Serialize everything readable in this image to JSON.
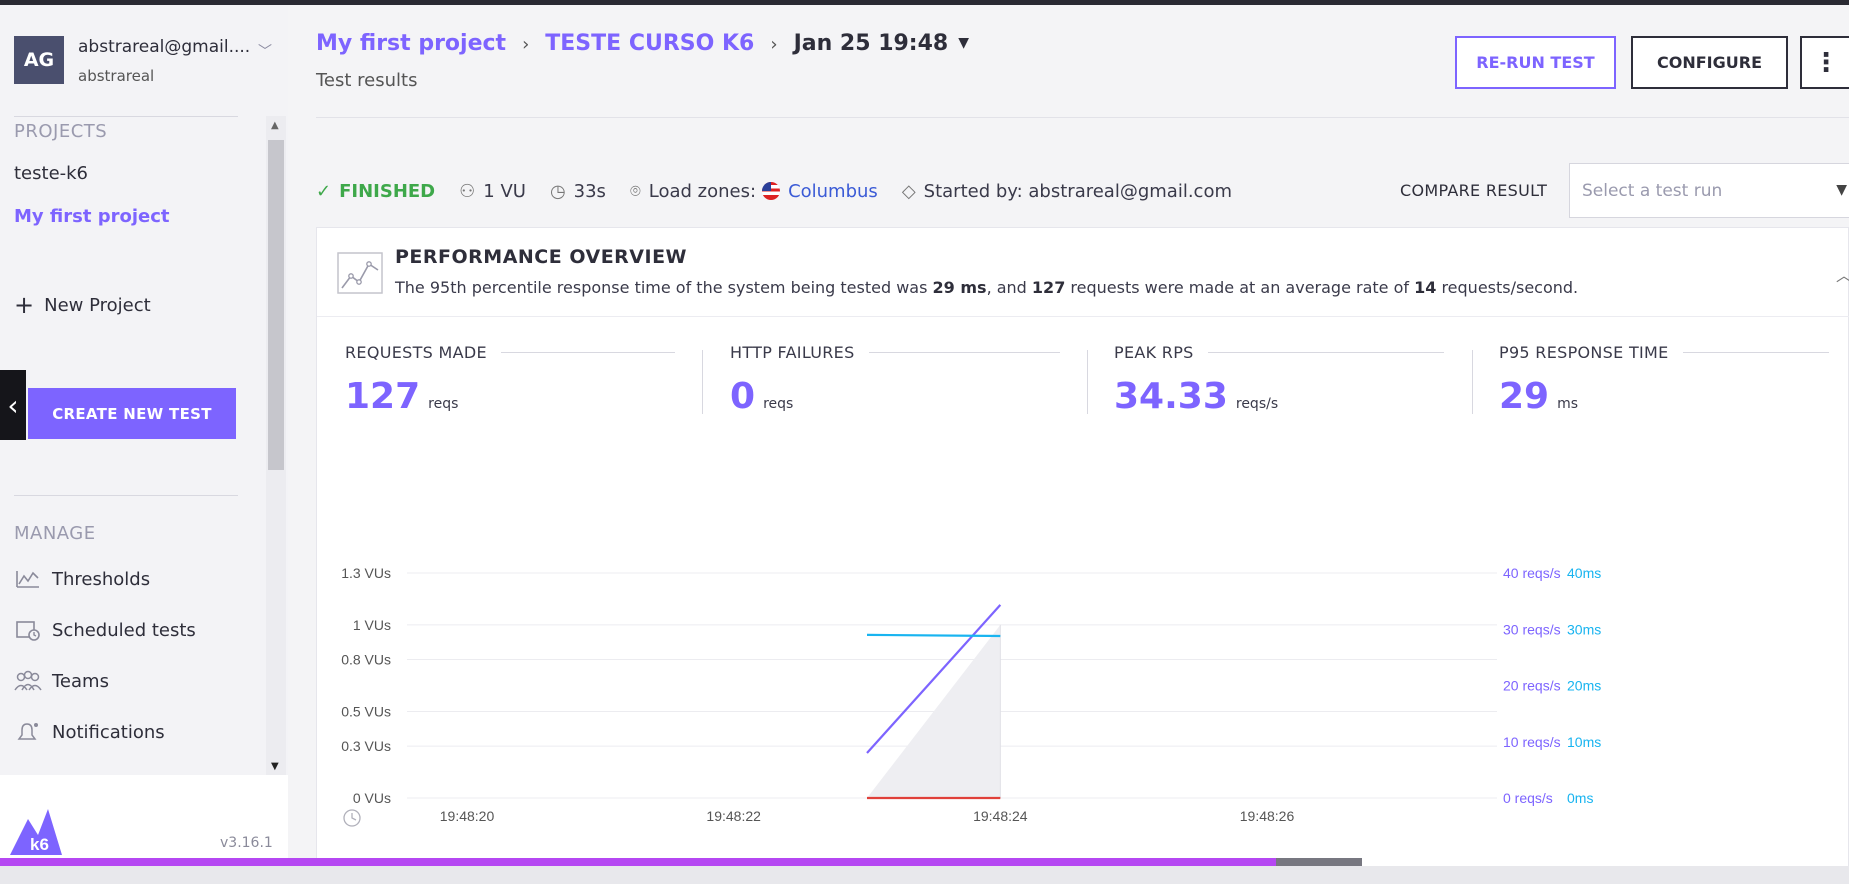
{
  "account": {
    "initials": "AG",
    "email": "abstrareal@gmail....",
    "username": "abstrareal"
  },
  "sidebar": {
    "projects_title": "PROJECTS",
    "projects": [
      {
        "label": "teste-k6"
      },
      {
        "label": "My first project"
      }
    ],
    "new_project": "New Project",
    "create_test": "CREATE NEW TEST",
    "manage_title": "MANAGE",
    "manage": [
      {
        "label": "Thresholds",
        "icon": "thresholds-icon"
      },
      {
        "label": "Scheduled tests",
        "icon": "calendar-clock-icon"
      },
      {
        "label": "Teams",
        "icon": "teams-icon"
      },
      {
        "label": "Notifications",
        "icon": "bell-icon"
      }
    ],
    "logo": "k6",
    "version": "v3.16.1"
  },
  "header": {
    "breadcrumb": [
      "My first project",
      "TESTE CURSO K6"
    ],
    "run_date": "Jan 25 19:48",
    "subtitle": "Test results",
    "rerun": "RE-RUN TEST",
    "configure": "CONFIGURE"
  },
  "status": {
    "state": "FINISHED",
    "vus": "1 VU",
    "duration": "33s",
    "load_zones_label": "Load zones:",
    "load_zone_city": "Columbus",
    "started_by": "Started by: abstrareal@gmail.com",
    "compare_label": "COMPARE RESULT",
    "compare_placeholder": "Select a test run"
  },
  "overview": {
    "title": "PERFORMANCE OVERVIEW",
    "desc_1": "The 95th percentile response time of the system being tested was ",
    "p95": "29 ms",
    "desc_2": ", and ",
    "requests": "127",
    "desc_3": " requests were made at an average rate of ",
    "rate": "14",
    "desc_4": " requests/second."
  },
  "metrics": [
    {
      "label": "REQUESTS MADE",
      "value": "127",
      "unit": "reqs"
    },
    {
      "label": "HTTP FAILURES",
      "value": "0",
      "unit": "reqs"
    },
    {
      "label": "PEAK RPS",
      "value": "34.33",
      "unit": "reqs/s"
    },
    {
      "label": "P95 RESPONSE TIME",
      "value": "29",
      "unit": "ms"
    }
  ],
  "colors": {
    "accent": "#7d64ff",
    "success": "#3ea84a",
    "response_time": "#18b4f0",
    "failures": "#e0403a"
  },
  "chart_data": {
    "type": "line",
    "x_ticks": [
      "19:48:20",
      "19:48:22",
      "19:48:24",
      "19:48:26"
    ],
    "left_axis_ticks": [
      "1.3 VUs",
      "1 VUs",
      "0.8 VUs",
      "0.5 VUs",
      "0.3 VUs",
      "0 VUs"
    ],
    "right_axis_rps_ticks": [
      "40 reqs/s",
      "30 reqs/s",
      "20 reqs/s",
      "10 reqs/s",
      "0 reqs/s"
    ],
    "right_axis_ms_ticks": [
      "40ms",
      "30ms",
      "20ms",
      "10ms",
      "0ms"
    ],
    "series": [
      {
        "axis": "rps",
        "x": [
          "19:48:23",
          "19:48:24"
        ],
        "values": [
          8,
          34.33
        ],
        "color": "#7d64ff"
      },
      {
        "axis": "ms",
        "x": [
          "19:48:23",
          "19:48:24"
        ],
        "values": [
          29,
          28.8
        ],
        "color": "#18b4f0"
      },
      {
        "axis": "vus",
        "x": [
          "19:48:23",
          "19:48:24"
        ],
        "values": [
          0,
          1
        ],
        "color": "#d8d8de"
      },
      {
        "axis": "rps",
        "x": [
          "19:48:23",
          "19:48:24"
        ],
        "values": [
          0,
          0
        ],
        "color": "#e0403a"
      }
    ]
  },
  "playback": {
    "progress": 0.69
  }
}
